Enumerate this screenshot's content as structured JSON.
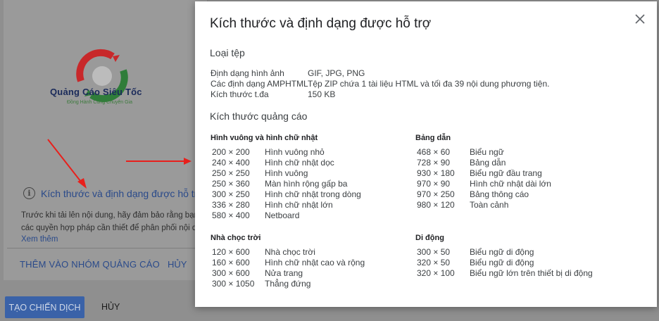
{
  "background": {
    "logo_text": "Quảng Cáo Siêu Tốc",
    "logo_subtext": "Đồng Hành Cùng Chuyên Gia",
    "info_link": "Kích thước và định dạng được hỗ trợ",
    "paragraph_line1": "Trước khi tải lên nội dung, hãy đảm bảo rằng bạn",
    "paragraph_line2": "các quyền hợp pháp cần thiết để phân phối nội d",
    "see_more": "Xem thêm",
    "add_to_group_button": "THÊM VÀO NHÓM QUẢNG CÁO",
    "cancel_button": "HỦY",
    "create_campaign_button": "TẠO CHIẾN DỊCH",
    "cancel_button_2": "HỦY"
  },
  "modal": {
    "title": "Kích thước và định dạng được hỗ trợ",
    "file_types_title": "Loại tệp",
    "file_types": [
      {
        "label": "Định dạng hình ảnh",
        "value": "GIF, JPG, PNG"
      },
      {
        "label": "Các định dạng AMPHTML",
        "value": "Tệp ZIP chứa 1 tài liệu HTML và tối đa 39 nội dung phương tiện."
      },
      {
        "label": "Kích thước t.đa",
        "value": "150 KB"
      }
    ],
    "ad_sizes_title": "Kích thước quảng cáo",
    "groups": {
      "square": {
        "title": "Hình vuông và hình chữ nhật",
        "rows": [
          {
            "size": "200 × 200",
            "name": "Hình vuông nhỏ"
          },
          {
            "size": "240 × 400",
            "name": "Hình chữ nhật dọc"
          },
          {
            "size": "250 × 250",
            "name": "Hình vuông"
          },
          {
            "size": "250 × 360",
            "name": "Màn hình rộng gấp ba"
          },
          {
            "size": "300 × 250",
            "name": "Hình chữ nhật trong dòng"
          },
          {
            "size": "336 × 280",
            "name": "Hình chữ nhật lớn"
          },
          {
            "size": "580 × 400",
            "name": "Netboard"
          }
        ]
      },
      "leaderboard": {
        "title": "Bảng dẫn",
        "rows": [
          {
            "size": "468 × 60",
            "name": "Biểu ngữ"
          },
          {
            "size": "728 × 90",
            "name": "Bảng dẫn"
          },
          {
            "size": "930 × 180",
            "name": "Biểu ngữ đầu trang"
          },
          {
            "size": "970 × 90",
            "name": "Hình chữ nhật dài lớn"
          },
          {
            "size": "970 × 250",
            "name": "Bảng thông cáo"
          },
          {
            "size": "980 × 120",
            "name": "Toàn cảnh"
          }
        ]
      },
      "skyscraper": {
        "title": "Nhà chọc trời",
        "rows": [
          {
            "size": "120 × 600",
            "name": "Nhà chọc trời"
          },
          {
            "size": "160 × 600",
            "name": "Hình chữ nhật cao và rộng"
          },
          {
            "size": "300 × 600",
            "name": "Nửa trang"
          },
          {
            "size": "300 × 1050",
            "name": "Thẳng đứng"
          }
        ]
      },
      "mobile": {
        "title": "Di động",
        "rows": [
          {
            "size": "300 × 50",
            "name": "Biểu ngữ di động"
          },
          {
            "size": "320 × 50",
            "name": "Biểu ngữ di động"
          },
          {
            "size": "320 × 100",
            "name": "Biểu ngữ lớn trên thiết bị di động"
          }
        ]
      }
    }
  },
  "colors": {
    "overlay": "#8f8f8f",
    "link": "#2a4a8a",
    "primary_button": "#3a62a8",
    "arrow": "#e8201c"
  }
}
